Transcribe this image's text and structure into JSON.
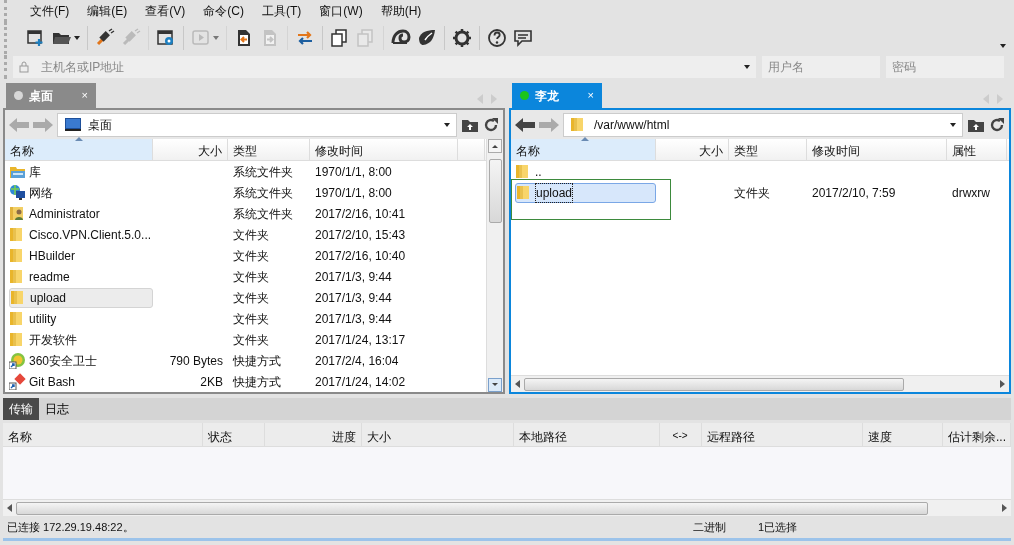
{
  "menu": [
    "文件(F)",
    "编辑(E)",
    "查看(V)",
    "命令(C)",
    "工具(T)",
    "窗口(W)",
    "帮助(H)"
  ],
  "toolbar": [
    {
      "kind": "new",
      "disabled": false,
      "caret": false,
      "separator_after": false
    },
    {
      "kind": "open",
      "disabled": false,
      "caret": true,
      "separator_after": true
    },
    {
      "kind": "connect",
      "disabled": false,
      "caret": false,
      "separator_after": false
    },
    {
      "kind": "disconnect",
      "disabled": true,
      "caret": false,
      "separator_after": true
    },
    {
      "kind": "properties",
      "disabled": false,
      "caret": false,
      "separator_after": true
    },
    {
      "kind": "play",
      "disabled": true,
      "caret": true,
      "separator_after": true
    },
    {
      "kind": "upload",
      "disabled": false,
      "caret": false,
      "separator_after": false
    },
    {
      "kind": "download",
      "disabled": true,
      "caret": false,
      "separator_after": true
    },
    {
      "kind": "transfer",
      "disabled": false,
      "caret": false,
      "separator_after": true
    },
    {
      "kind": "copy",
      "disabled": false,
      "caret": false,
      "separator_after": false
    },
    {
      "kind": "paste",
      "disabled": true,
      "caret": false,
      "separator_after": true
    },
    {
      "kind": "shell",
      "disabled": false,
      "caret": false,
      "separator_after": false
    },
    {
      "kind": "terminal",
      "disabled": false,
      "caret": false,
      "separator_after": true
    },
    {
      "kind": "settings",
      "disabled": false,
      "caret": false,
      "separator_after": true
    },
    {
      "kind": "help",
      "disabled": false,
      "caret": false,
      "separator_after": false
    },
    {
      "kind": "chat",
      "disabled": false,
      "caret": false,
      "separator_after": false
    }
  ],
  "address_bar": {
    "host_placeholder": "主机名或IP地址",
    "user_placeholder": "用户名",
    "password_placeholder": "密码"
  },
  "panels": [
    {
      "active": false,
      "tab": {
        "label": "桌面",
        "connected": false,
        "close": "×"
      },
      "back_enabled": false,
      "path": {
        "text": "桌面",
        "kind": "desktop"
      },
      "columns": [
        {
          "label": "名称",
          "sorted": true
        },
        {
          "label": "大小",
          "sorted": false
        },
        {
          "label": "类型",
          "sorted": false
        },
        {
          "label": "修改时间",
          "sorted": false
        }
      ],
      "rows": [
        {
          "kind": "library",
          "name": "库",
          "size": "",
          "type": "系统文件夹",
          "modified": "1970/1/1, 8:00",
          "selected": false
        },
        {
          "kind": "network",
          "name": "网络",
          "size": "",
          "type": "系统文件夹",
          "modified": "1970/1/1, 8:00",
          "selected": false
        },
        {
          "kind": "user",
          "name": "Administrator",
          "size": "",
          "type": "系统文件夹",
          "modified": "2017/2/16, 10:41",
          "selected": false
        },
        {
          "kind": "folder",
          "name": "Cisco.VPN.Client.5.0...",
          "size": "",
          "type": "文件夹",
          "modified": "2017/2/10, 15:43",
          "selected": false
        },
        {
          "kind": "folder",
          "name": "HBuilder",
          "size": "",
          "type": "文件夹",
          "modified": "2017/2/16, 10:40",
          "selected": false
        },
        {
          "kind": "folder",
          "name": "readme",
          "size": "",
          "type": "文件夹",
          "modified": "2017/1/3, 9:44",
          "selected": false
        },
        {
          "kind": "folder",
          "name": "upload",
          "size": "",
          "type": "文件夹",
          "modified": "2017/1/3, 9:44",
          "selected": true
        },
        {
          "kind": "folder",
          "name": "utility",
          "size": "",
          "type": "文件夹",
          "modified": "2017/1/3, 9:44",
          "selected": false
        },
        {
          "kind": "folder",
          "name": "开发软件",
          "size": "",
          "type": "文件夹",
          "modified": "2017/1/24, 13:17",
          "selected": false
        },
        {
          "kind": "shortcut-shield",
          "name": "360安全卫士",
          "size": "790 Bytes",
          "type": "快捷方式",
          "modified": "2017/2/4, 16:04",
          "selected": false
        },
        {
          "kind": "shortcut-diamond",
          "name": "Git Bash",
          "size": "2KB",
          "type": "快捷方式",
          "modified": "2017/1/24, 14:02",
          "selected": false
        }
      ]
    },
    {
      "active": true,
      "tab": {
        "label": "李龙",
        "connected": true,
        "close": "×"
      },
      "back_enabled": true,
      "path": {
        "text": "/var/www/html",
        "kind": "folder"
      },
      "columns": [
        {
          "label": "名称",
          "sorted": true
        },
        {
          "label": "大小",
          "sorted": false
        },
        {
          "label": "类型",
          "sorted": false
        },
        {
          "label": "修改时间",
          "sorted": false
        },
        {
          "label": "属性",
          "sorted": false
        }
      ],
      "rows": [
        {
          "kind": "folder",
          "name": "..",
          "size": "",
          "type": "",
          "modified": "",
          "selected": false,
          "annotated": false
        },
        {
          "kind": "folder",
          "name": "upload",
          "size": "",
          "type": "文件夹",
          "modified": "2017/2/10, 7:59",
          "attributes": "drwxrw",
          "selected": true,
          "annotated": true
        }
      ]
    }
  ],
  "bottom_tabs": [
    {
      "label": "传输",
      "selected": true
    },
    {
      "label": "日志",
      "selected": false
    }
  ],
  "transfer_columns": [
    "名称",
    "状态",
    "进度",
    "大小",
    "本地路径",
    "<->",
    "远程路径",
    "速度",
    "估计剩余..."
  ],
  "status_bar": {
    "connection": "已连接 172.29.19.48:22。",
    "mode": "二进制",
    "selection": "1已选择"
  }
}
